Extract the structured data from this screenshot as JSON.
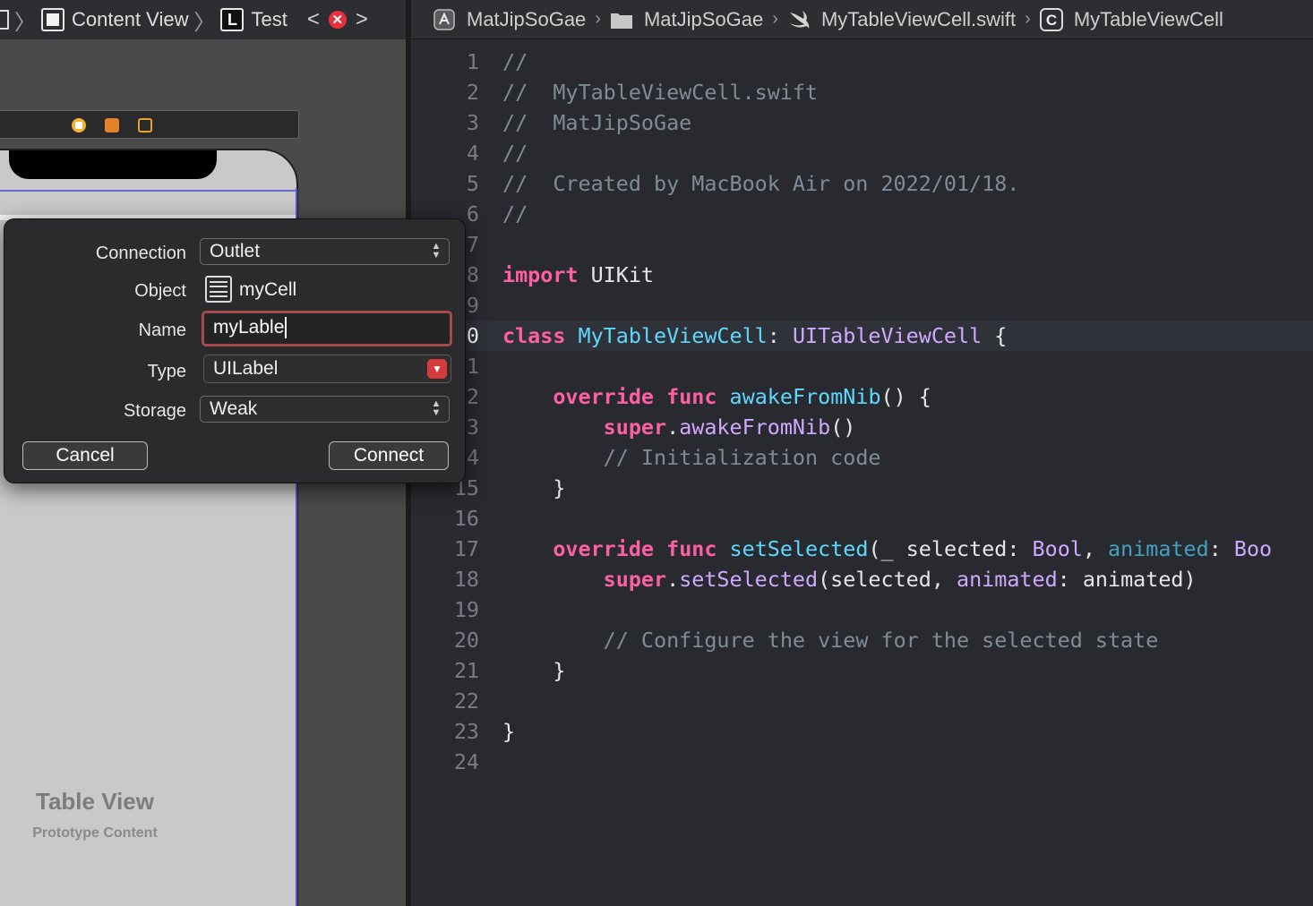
{
  "left_toolbar": {
    "breadcrumb": [
      {
        "label": "Content View",
        "icon": "view-icon"
      },
      {
        "label": "Test",
        "icon": "label-L-icon"
      }
    ],
    "error_badge": "✕"
  },
  "jumpbar": {
    "items": [
      {
        "label": "MatJipSoGae",
        "icon": "project-icon"
      },
      {
        "label": "MatJipSoGae",
        "icon": "folder-icon"
      },
      {
        "label": "MyTableViewCell.swift",
        "icon": "swift-file-icon"
      },
      {
        "label": "MyTableViewCell",
        "icon": "class-c-icon"
      }
    ]
  },
  "canvas": {
    "table_title": "Table View",
    "table_subtitle": "Prototype Content"
  },
  "code": {
    "current_line": 10,
    "line_numbers": [
      "1",
      "2",
      "3",
      "4",
      "5",
      "6",
      "7",
      "8",
      "9",
      "0",
      "1",
      "2",
      "3",
      "4",
      "15",
      "16",
      "17",
      "18",
      "19",
      "20",
      "21",
      "22",
      "23",
      "24"
    ],
    "lines": [
      [
        [
          "cm",
          "//"
        ]
      ],
      [
        [
          "cm",
          "//  MyTableViewCell.swift"
        ]
      ],
      [
        [
          "cm",
          "//  MatJipSoGae"
        ]
      ],
      [
        [
          "cm",
          "//"
        ]
      ],
      [
        [
          "cm",
          "//  Created by MacBook Air on 2022/01/18."
        ]
      ],
      [
        [
          "cm",
          "//"
        ]
      ],
      [],
      [
        [
          "kw",
          "import"
        ],
        [
          "pl",
          " UIKit"
        ]
      ],
      [],
      [
        [
          "kw",
          "class"
        ],
        [
          "pl",
          " "
        ],
        [
          "tp",
          "MyTableViewCell"
        ],
        [
          "pl",
          ": "
        ],
        [
          "cls",
          "UITableViewCell"
        ],
        [
          "pl",
          " {"
        ]
      ],
      [],
      [
        [
          "pl",
          "    "
        ],
        [
          "kw",
          "override"
        ],
        [
          "pl",
          " "
        ],
        [
          "kw",
          "func"
        ],
        [
          "pl",
          " "
        ],
        [
          "tp",
          "awakeFromNib"
        ],
        [
          "pl",
          "() {"
        ]
      ],
      [
        [
          "pl",
          "        "
        ],
        [
          "kw",
          "super"
        ],
        [
          "pl",
          "."
        ],
        [
          "cls",
          "awakeFromNib"
        ],
        [
          "pl",
          "()"
        ]
      ],
      [
        [
          "pl",
          "        "
        ],
        [
          "cm",
          "// Initialization code"
        ]
      ],
      [
        [
          "pl",
          "    }"
        ]
      ],
      [],
      [
        [
          "pl",
          "    "
        ],
        [
          "kw",
          "override"
        ],
        [
          "pl",
          " "
        ],
        [
          "kw",
          "func"
        ],
        [
          "pl",
          " "
        ],
        [
          "tp",
          "setSelected"
        ],
        [
          "pl",
          "(_ selected: "
        ],
        [
          "cls",
          "Bool"
        ],
        [
          "pl",
          ", "
        ],
        [
          "dc",
          "animated"
        ],
        [
          "pl",
          ": "
        ],
        [
          "cls",
          "Boo"
        ]
      ],
      [
        [
          "pl",
          "        "
        ],
        [
          "kw",
          "super"
        ],
        [
          "pl",
          "."
        ],
        [
          "cls",
          "setSelected"
        ],
        [
          "pl",
          "(selected, "
        ],
        [
          "cls",
          "animated"
        ],
        [
          "pl",
          ": animated)"
        ]
      ],
      [],
      [
        [
          "pl",
          "        "
        ],
        [
          "cm",
          "// Configure the view for the selected state"
        ]
      ],
      [
        [
          "pl",
          "    }"
        ]
      ],
      [],
      [
        [
          "pl",
          "}"
        ]
      ],
      []
    ]
  },
  "popover": {
    "connection": {
      "label": "Connection",
      "value": "Outlet"
    },
    "object": {
      "label": "Object",
      "value": "myCell"
    },
    "name": {
      "label": "Name",
      "value": "myLable"
    },
    "type": {
      "label": "Type",
      "value": "UILabel"
    },
    "storage": {
      "label": "Storage",
      "value": "Weak"
    },
    "cancel_label": "Cancel",
    "connect_label": "Connect"
  },
  "colors": {
    "keyword": "#fc5fa3",
    "comment": "#7f8c98",
    "type_decl": "#5dd8ff",
    "class_ref": "#d0a8ff",
    "param": "#41a1c0",
    "error_red": "#e8303a",
    "name_field_border": "#a34a4f"
  }
}
